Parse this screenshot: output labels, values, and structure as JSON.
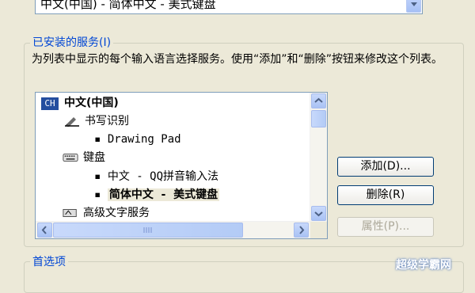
{
  "top_select": {
    "value": "中文(中国) - 简体中文 - 美式键盘"
  },
  "installed": {
    "title": "已安装的服务(I)",
    "description": "为列表中显示的每个输入语言选择服务。使用“添加”和“删除”按钮来修改这个列表。"
  },
  "tree": {
    "language": {
      "badge": "CH",
      "label": "中文(中国)"
    },
    "handwriting": {
      "label": "书写识别",
      "item": "Drawing Pad"
    },
    "keyboard": {
      "label": "键盘",
      "items": [
        "中文 - QQ拼音输入法",
        "简体中文 - 美式键盘"
      ]
    },
    "advanced": {
      "label": "高级文字服务"
    }
  },
  "buttons": {
    "add": "添加(D)...",
    "remove": "删除(R)",
    "properties": "属性(P)..."
  },
  "preferences": {
    "title": "首选项"
  },
  "watermark": "超级学霸网"
}
